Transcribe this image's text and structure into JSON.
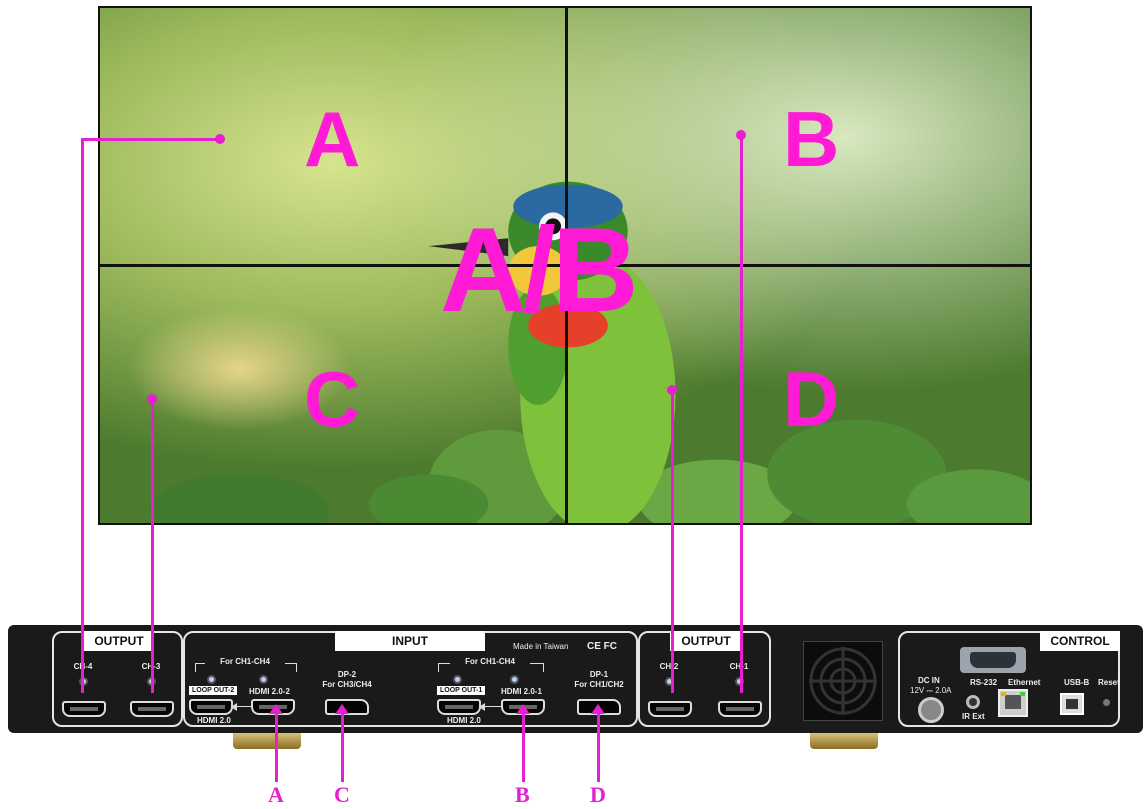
{
  "wall": {
    "zones": [
      "A",
      "B",
      "C",
      "D"
    ],
    "center_label": "A/B"
  },
  "device": {
    "output_left": {
      "title": "OUTPUT",
      "ports": [
        "CH-4",
        "CH-3"
      ]
    },
    "input": {
      "title": "INPUT",
      "made_in": "Made in Taiwan",
      "cert_marks": "CE FC",
      "group1": {
        "bracket_label": "For CH1-CH4",
        "loop_label": "LOOP OUT-2",
        "loop_port_label": "HDMI 2.0",
        "hdmi_label": "HDMI 2.0-2",
        "dp_label": "DP-2",
        "dp_sub": "For CH3/CH4"
      },
      "group2": {
        "bracket_label": "For CH1-CH4",
        "loop_label": "LOOP OUT-1",
        "loop_port_label": "HDMI 2.0",
        "hdmi_label": "HDMI 2.0-1",
        "dp_label": "DP-1",
        "dp_sub": "For CH1/CH2"
      }
    },
    "output_right": {
      "title": "OUTPUT",
      "ports": [
        "CH-2",
        "CH-1"
      ]
    },
    "control": {
      "title": "CONTROL",
      "dc_in": "DC IN",
      "dc_spec": "12V ⎓ 2.0A",
      "ir_ext": "IR Ext",
      "rs232": "RS-232",
      "ethernet": "Ethernet",
      "usb_b": "USB-B",
      "reset": "Reset"
    }
  },
  "source_letters": [
    "A",
    "C",
    "B",
    "D"
  ],
  "colors": {
    "connector_line": "#e61fd0",
    "zone_text": "#ff1ad6",
    "chassis": "#1a1a1a"
  }
}
